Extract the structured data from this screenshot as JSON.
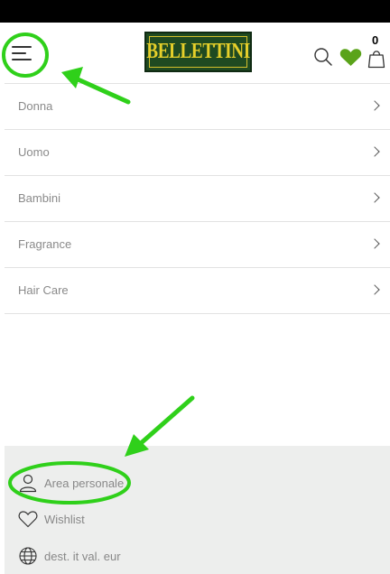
{
  "header": {
    "logo_text": "BELLETTINI",
    "cart_count": "0",
    "colors": {
      "logo_bg": "#1f4a21",
      "logo_text": "#e6cf2a",
      "heart": "#5aa31a",
      "annotation": "#2fd01a"
    },
    "icons": [
      "hamburger-menu-icon",
      "search-icon",
      "heart-icon",
      "shopping-bag-icon"
    ]
  },
  "menu": {
    "items": [
      {
        "label": "Donna"
      },
      {
        "label": "Uomo"
      },
      {
        "label": "Bambini"
      },
      {
        "label": "Fragrance"
      },
      {
        "label": "Hair Care"
      }
    ]
  },
  "footer": {
    "account_label": "Area personale",
    "wishlist_label": "Wishlist",
    "locale_label": "dest. it val. eur"
  }
}
